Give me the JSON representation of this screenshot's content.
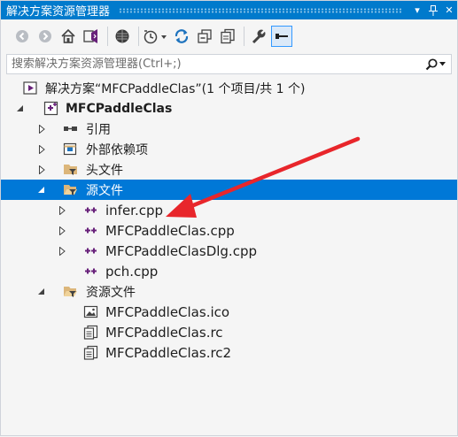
{
  "window": {
    "title": "解决方案资源管理器",
    "dropdown_glyph": "▾",
    "pin_glyph": "╀",
    "close_glyph": "✕"
  },
  "toolbar": {
    "buttons": [
      "back-icon",
      "forward-icon",
      "home-icon",
      "switch-views-icon",
      "preview-icon",
      "pending-changes-icon",
      "sync-icon",
      "collapse-all-icon",
      "copy-icon",
      "properties-icon",
      "show-all-files-icon"
    ]
  },
  "search": {
    "placeholder": "搜索解决方案资源管理器(Ctrl+;)",
    "value": ""
  },
  "tree": {
    "solution": "解决方案“MFCPaddleClas”(1 个项目/共 1 个)",
    "project": "MFCPaddleClas",
    "references": "引用",
    "external_deps": "外部依赖项",
    "headers": "头文件",
    "sources": "源文件",
    "source_files": [
      "infer.cpp",
      "MFCPaddleClas.cpp",
      "MFCPaddleClasDlg.cpp",
      "pch.cpp"
    ],
    "resources": "资源文件",
    "resource_files": [
      "MFCPaddleClas.ico",
      "MFCPaddleClas.rc",
      "MFCPaddleClas.rc2"
    ]
  },
  "colors": {
    "titlebar": "#007acc",
    "selection": "#0078d7",
    "annotation_arrow": "#e8262b",
    "cpp_icon": "#68217a"
  }
}
